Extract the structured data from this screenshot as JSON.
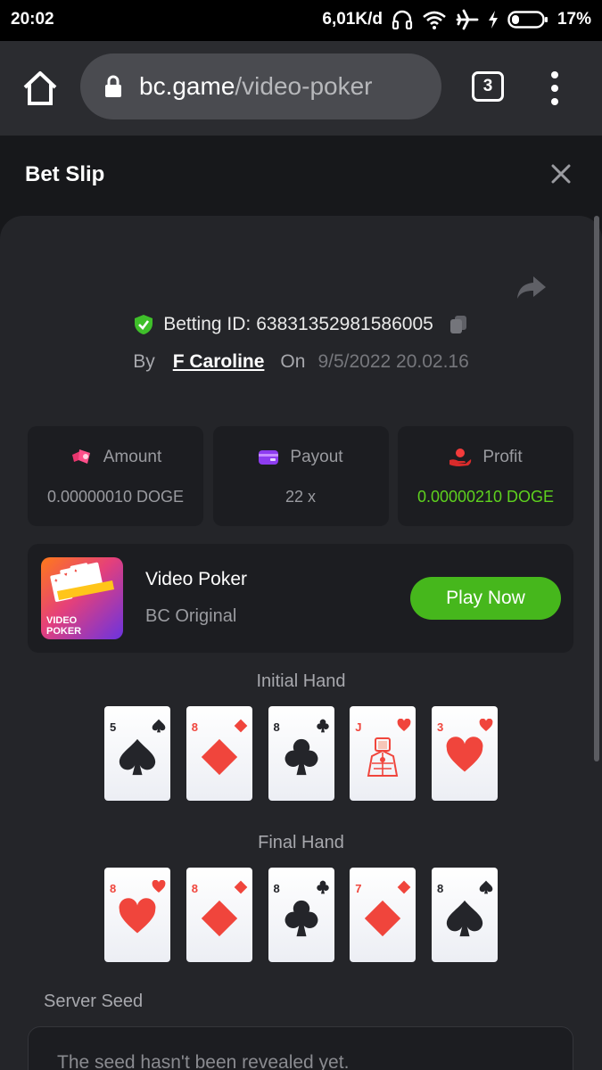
{
  "status_bar": {
    "time": "20:02",
    "network_speed": "6,01K/d",
    "battery": "17%",
    "icons": [
      "headset-icon",
      "wifi-icon",
      "airplane-icon",
      "charging-icon",
      "battery-icon"
    ]
  },
  "browser": {
    "url_host": "bc.game",
    "url_path": "/video-poker",
    "tab_count": "3",
    "icons": [
      "home-icon",
      "lock-icon",
      "more-vert-icon"
    ]
  },
  "modal": {
    "title": "Bet Slip"
  },
  "bet": {
    "betting_id_label": "Betting ID:",
    "betting_id": "63831352981586005",
    "by_label": "By",
    "user": "F Caroline",
    "on_label": "On",
    "date": "9/5/2022 20.02.16"
  },
  "stats": [
    {
      "label": "Amount",
      "value": "0.00000010 DOGE",
      "icon": "bet-chips-icon"
    },
    {
      "label": "Payout",
      "value": "22 x",
      "icon": "wallet-icon"
    },
    {
      "label": "Profit",
      "value": "0.00000210 DOGE",
      "icon": "hand-coins-icon"
    }
  ],
  "game": {
    "name": "Video Poker",
    "subtitle": "BC Original",
    "play_label": "Play Now",
    "thumb_text_line1": "VIDEO",
    "thumb_text_line2": "POKER"
  },
  "initial_hand": {
    "label": "Initial Hand",
    "cards": [
      {
        "rank": "5",
        "suit": "spades"
      },
      {
        "rank": "8",
        "suit": "diamonds"
      },
      {
        "rank": "8",
        "suit": "clubs"
      },
      {
        "rank": "J",
        "suit": "hearts"
      },
      {
        "rank": "3",
        "suit": "hearts"
      }
    ]
  },
  "final_hand": {
    "label": "Final Hand",
    "cards": [
      {
        "rank": "8",
        "suit": "hearts"
      },
      {
        "rank": "8",
        "suit": "diamonds"
      },
      {
        "rank": "8",
        "suit": "clubs"
      },
      {
        "rank": "7",
        "suit": "diamonds"
      },
      {
        "rank": "8",
        "suit": "spades"
      }
    ]
  },
  "server_seed": {
    "label": "Server Seed",
    "value": "The seed hasn't been revealed yet."
  },
  "colors": {
    "accent_green": "#46b71c",
    "profit_green": "#5ed21e",
    "suit_red": "#f0453c",
    "suit_black": "#24252a"
  }
}
